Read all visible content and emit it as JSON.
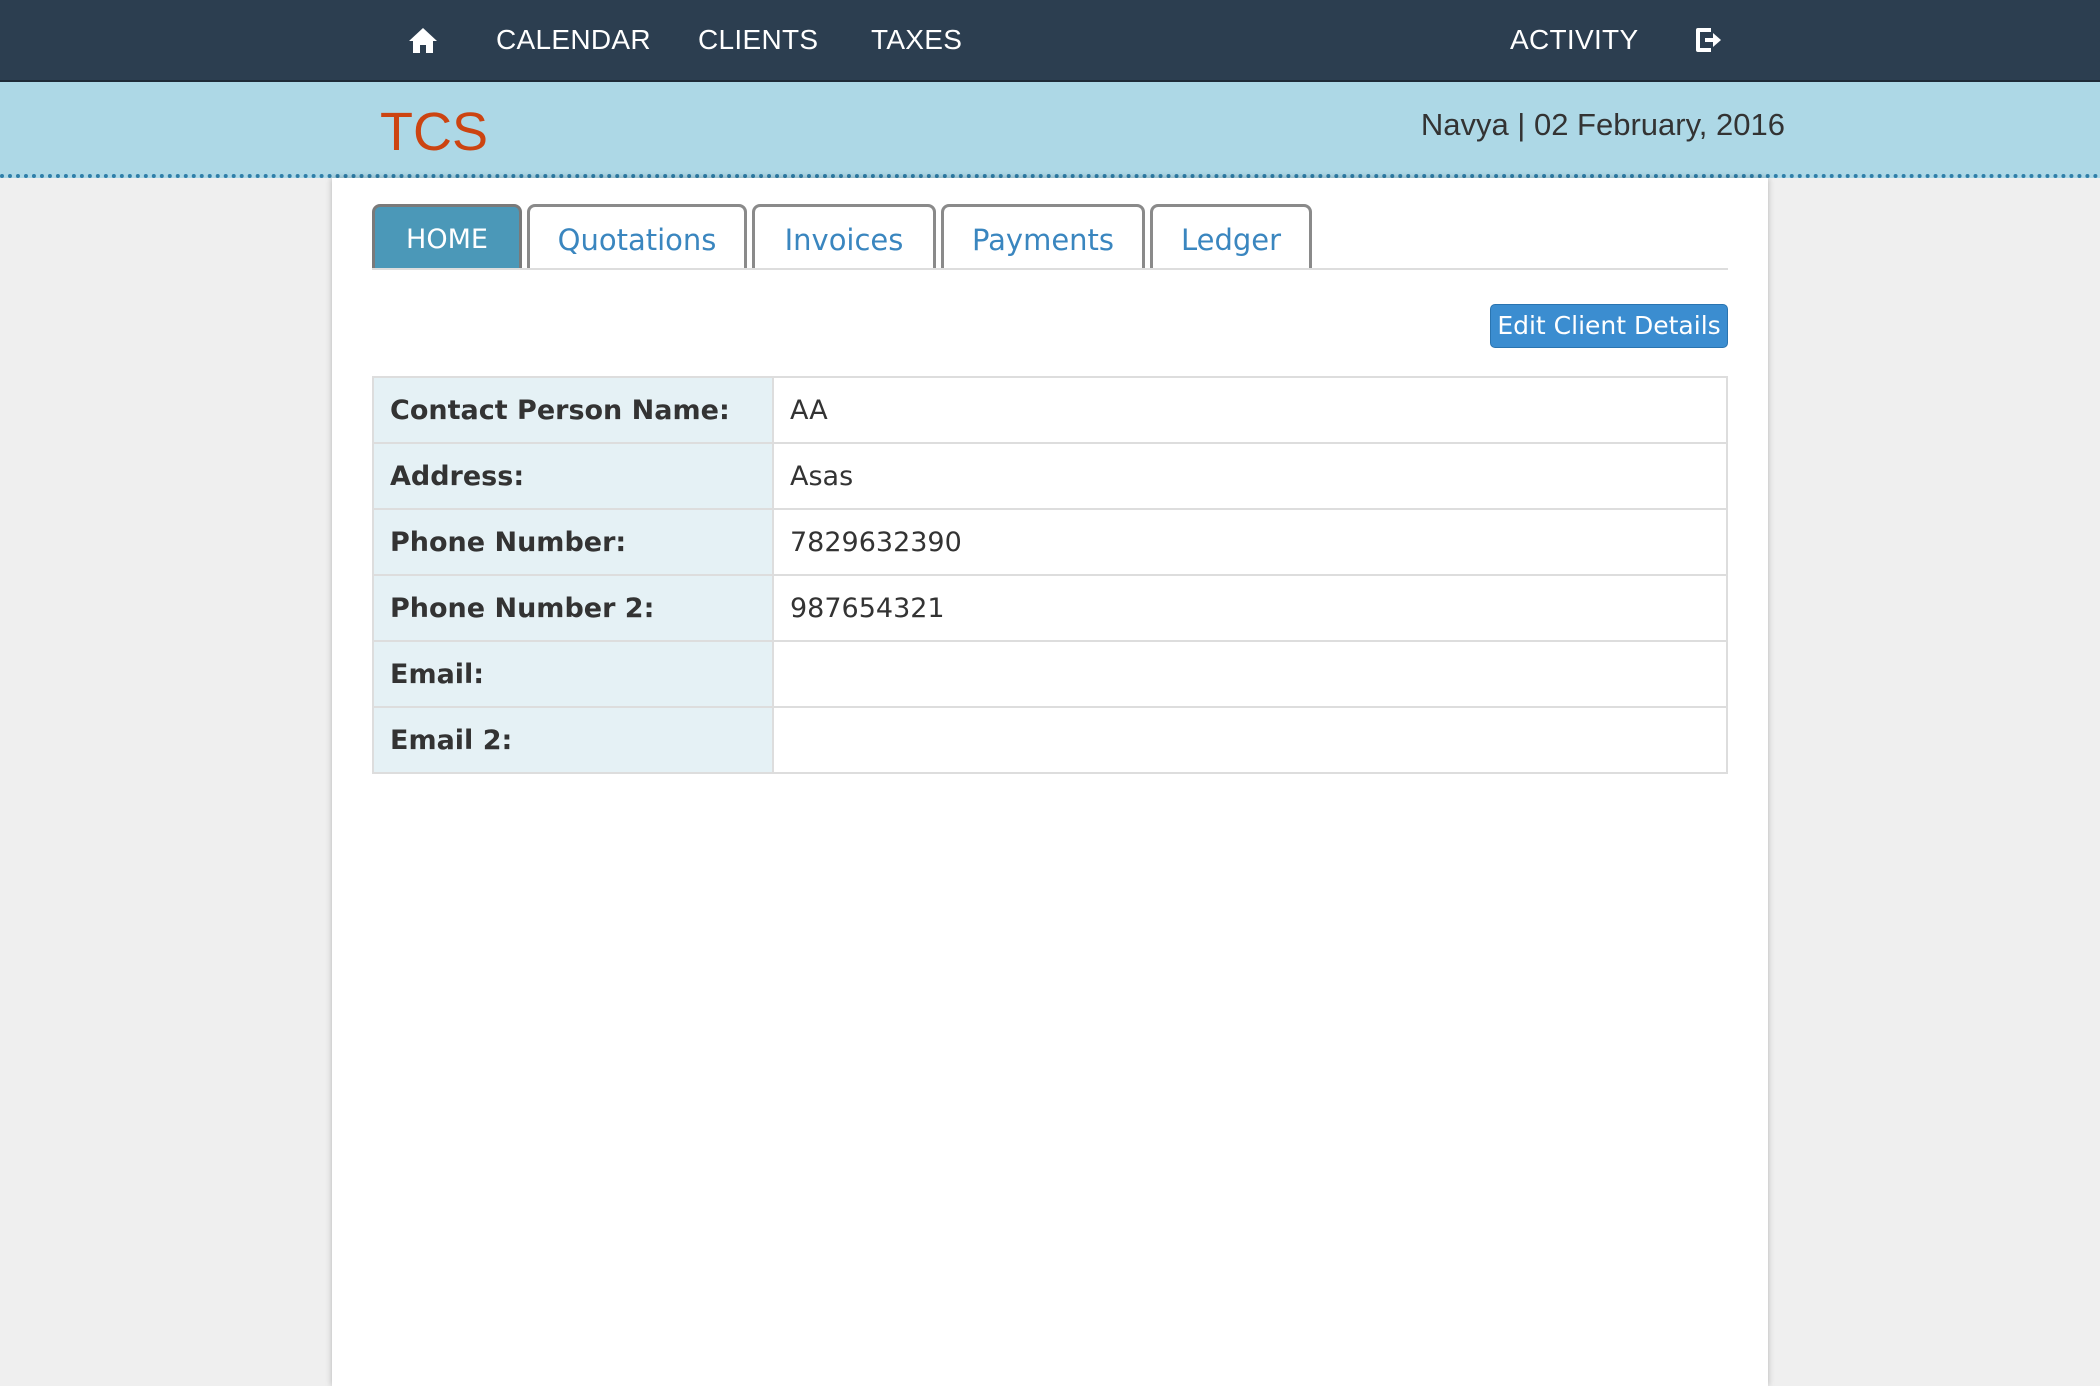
{
  "nav": {
    "home_icon": "home-icon",
    "calendar": "CALENDAR",
    "clients": "CLIENTS",
    "taxes": "TAXES",
    "activity": "ACTIVITY",
    "logout_icon": "logout-icon"
  },
  "header": {
    "brand": "TCS",
    "user_date": "Navya | 02 February, 2016"
  },
  "tabs": [
    {
      "label": "HOME",
      "active": true
    },
    {
      "label": "Quotations",
      "active": false
    },
    {
      "label": "Invoices",
      "active": false
    },
    {
      "label": "Payments",
      "active": false
    },
    {
      "label": "Ledger",
      "active": false
    }
  ],
  "actions": {
    "edit_client": "Edit Client Details"
  },
  "client": {
    "rows": [
      {
        "label": "Contact Person Name:",
        "value": "AA"
      },
      {
        "label": "Address:",
        "value": "Asas"
      },
      {
        "label": "Phone Number:",
        "value": "7829632390"
      },
      {
        "label": "Phone Number 2:",
        "value": "987654321"
      },
      {
        "label": "Email:",
        "value": ""
      },
      {
        "label": "Email 2:",
        "value": ""
      }
    ]
  },
  "colors": {
    "nav_bg": "#2c3e50",
    "header_bg": "#add8e6",
    "brand": "#cc4411",
    "active_tab": "#4b98b8",
    "link": "#3a86bf",
    "button": "#3b8dd0",
    "label_cell": "#e5f1f5"
  }
}
